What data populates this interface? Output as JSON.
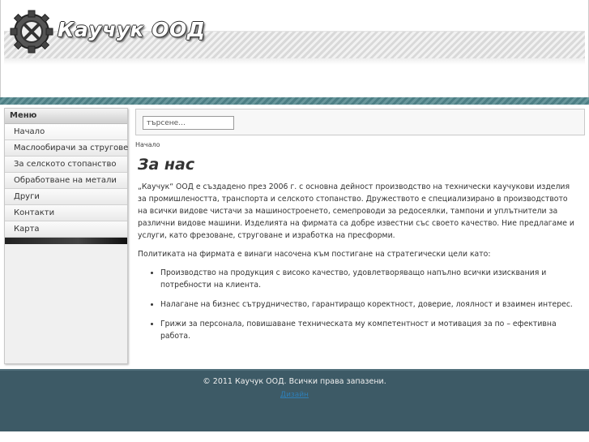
{
  "header": {
    "site_title": "Каучук ООД",
    "logo_icon": "gear-tire-logo-icon"
  },
  "sidebar": {
    "menu_heading": "Меню",
    "items": [
      {
        "label": "Начало"
      },
      {
        "label": "Маслообирачи за стругове"
      },
      {
        "label": "За селското стопанство"
      },
      {
        "label": "Обработване на метали"
      },
      {
        "label": "Други"
      },
      {
        "label": "Контакти"
      },
      {
        "label": "Карта"
      }
    ]
  },
  "search": {
    "value": "търсене..."
  },
  "main": {
    "breadcrumb": "Начало",
    "title": "За нас",
    "paragraph1": "„Каучук“ ООД е създадено през 2006 г. с основна дейност производство на технически каучукови изделия за промишлеността, транспорта и селското стопанство. Дружеството е специализирано в производството на всички видове чистачи за машиностроенето, семепроводи за редосеялки, тампони и уплътнители за различни видове машини. Изделията на фирмата са добре известни със своето качество. Ние предлагаме и услуги, като фрезоване, струговане и изработка на пресформи.",
    "paragraph2": "Политиката на фирмата е винаги насочена към постигане на стратегически цели като:",
    "bullets": [
      "Производство на продукция с високо качество, удовлетворяващо напълно всички изисквания и потребности на клиента.",
      "Налагане на бизнес сътрудничество, гарантиращо коректност, доверие, лоялност и взаимен интерес.",
      "Грижи за персонала, повишаване техническата му компетентност и мотивация за по – ефективна работа."
    ]
  },
  "footer": {
    "copyright": "© 2011 Каучук ООД. Всички права запазени.",
    "link": "Дизайн"
  },
  "colors": {
    "teal_bar": "#4d7f85",
    "footer_bg": "#3d5a66",
    "footer_link": "#2f7fb8"
  }
}
